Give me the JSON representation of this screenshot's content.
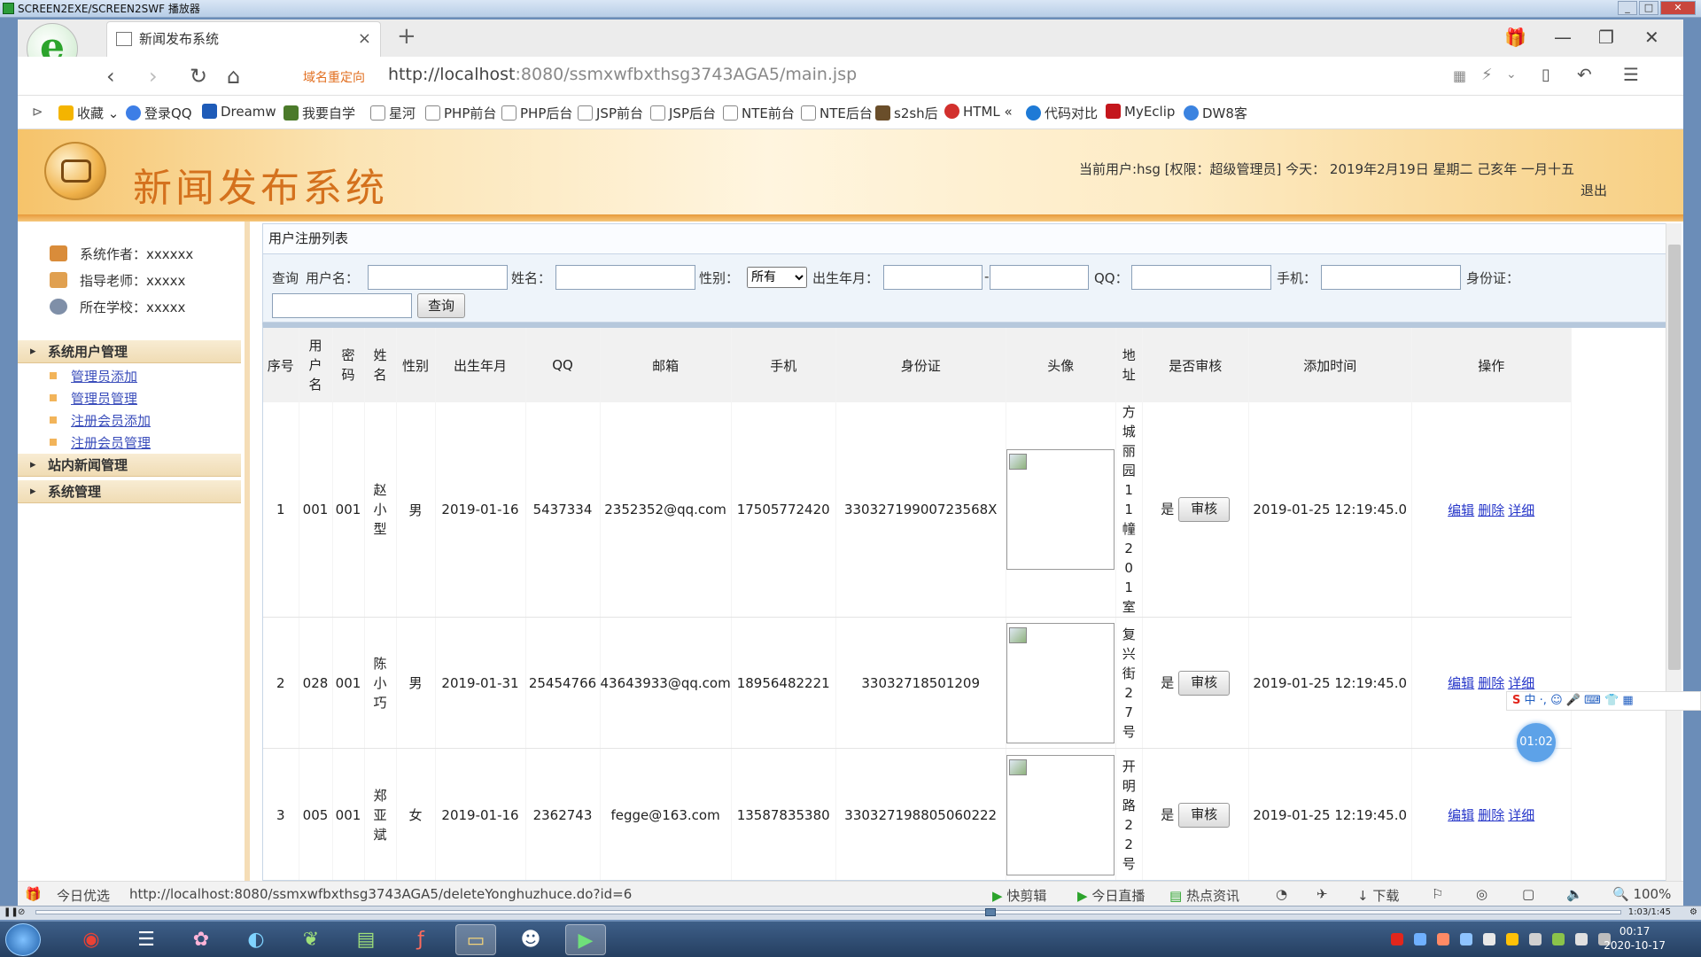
{
  "player": {
    "title": "SCREEN2EXE/SCREEN2SWF 播放器",
    "time": "1:03/1:45"
  },
  "browser": {
    "tab_title": "新闻发布系统",
    "redirect_label": "域名重定向",
    "url_host": "http://localhost",
    "url_rest": ":8080/ssmxwfbxthsg3743AGA5/main.jsp",
    "bookmarks": [
      "收藏",
      "登录QQ",
      "Dreamw",
      "我要自学",
      "星河",
      "PHP前台",
      "PHP后台",
      "JSP前台",
      "JSP后台",
      "NTE前台",
      "NTE后台",
      "s2sh后",
      "HTML",
      "代码对比",
      "MyEclip",
      "DW8客"
    ],
    "status_left": "今日优选",
    "status_url": "http://localhost:8080/ssmxwfbxthsg3743AGA5/deleteYonghuzhuce.do?id=6",
    "status_items": [
      "快剪辑",
      "今日直播",
      "热点资讯",
      "下载",
      "100%"
    ]
  },
  "site": {
    "title": "新闻发布系统",
    "user_info": "当前用户:hsg [权限：超级管理员] 今天： 2019年2月19日 星期二 己亥年 一月十五",
    "logout": "退出"
  },
  "sidebar": {
    "info": [
      {
        "label": "系统作者：xxxxxx",
        "icon": "user-icon",
        "color": "#d98c3a"
      },
      {
        "label": "指导老师：xxxxx",
        "icon": "teacher-icon",
        "color": "#e0a050"
      },
      {
        "label": "所在学校：xxxxx",
        "icon": "school-icon",
        "color": "#7f8fa8"
      }
    ],
    "menu1": "系统用户管理",
    "menu1_items": [
      "管理员添加",
      "管理员管理",
      "注册会员添加",
      "注册会员管理"
    ],
    "menu2": "站内新闻管理",
    "menu3": "系统管理"
  },
  "panel": {
    "title": "用户注册列表"
  },
  "search": {
    "query_label": "查询",
    "username_label": "用户名：",
    "name_label": "姓名：",
    "gender_label": "性别：",
    "gender_value": "所有",
    "birth_label": "出生年月：",
    "qq_label": "QQ：",
    "phone_label": "手机：",
    "idcard_label": "身份证：",
    "button": "查询"
  },
  "table": {
    "headers": [
      "序号",
      "用户名",
      "密码",
      "姓名",
      "性别",
      "出生年月",
      "QQ",
      "邮箱",
      "手机",
      "身份证",
      "头像",
      "地址",
      "是否审核",
      "添加时间",
      "操作"
    ],
    "rows": [
      {
        "no": "1",
        "username": "001",
        "password": "001",
        "name": "赵小型",
        "gender": "男",
        "birth": "2019-01-16",
        "qq": "5437334",
        "email": "2352352@qq.com",
        "phone": "17505772420",
        "idcard": "33032719900723568X",
        "address": "方城丽园11幢201室",
        "audited": "是",
        "audit_btn": "审核",
        "added": "2019-01-25 12:19:45.0",
        "edit": "编辑",
        "delete": "删除",
        "detail": "详细"
      },
      {
        "no": "2",
        "username": "028",
        "password": "001",
        "name": "陈小巧",
        "gender": "男",
        "birth": "2019-01-31",
        "qq": "25454766",
        "email": "43643933@qq.com",
        "phone": "18956482221",
        "idcard": "33032718501209",
        "address": "复兴街27号",
        "audited": "是",
        "audit_btn": "审核",
        "added": "2019-01-25 12:19:45.0",
        "edit": "编辑",
        "delete": "删除",
        "detail": "详细"
      },
      {
        "no": "3",
        "username": "005",
        "password": "001",
        "name": "郑亚斌",
        "gender": "女",
        "birth": "2019-01-16",
        "qq": "2362743",
        "email": "fegge@163.com",
        "phone": "13587835380",
        "idcard": "330327198805060222",
        "address": "开明路22号",
        "audited": "是",
        "audit_btn": "审核",
        "added": "2019-01-25 12:19:45.0",
        "edit": "编辑",
        "delete": "删除",
        "detail": "详细"
      }
    ]
  },
  "ime": {
    "label": "中"
  },
  "timer": "01:02",
  "taskbar": {
    "time": "00:17",
    "date": "2020-10-17"
  }
}
